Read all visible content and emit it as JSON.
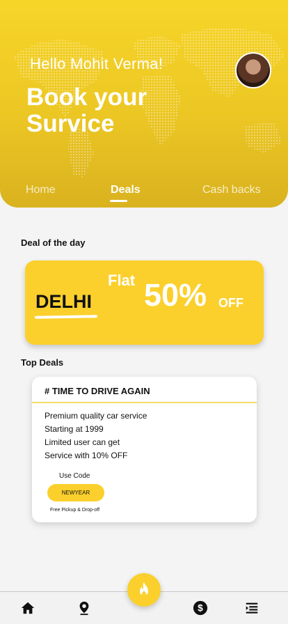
{
  "header": {
    "greeting": "Hello Mohit Verma!",
    "headline": "Book your Survice",
    "tabs": [
      {
        "label": "Home",
        "active": false
      },
      {
        "label": "Deals",
        "active": true
      },
      {
        "label": "Cash backs",
        "active": false
      }
    ]
  },
  "deal_of_day": {
    "section_title": "Deal of the day",
    "city": "DELHI",
    "flat": "Flat",
    "percent": "50%",
    "off": "OFF"
  },
  "top_deals": {
    "section_title": "Top Deals",
    "card": {
      "title": "# TIME TO DRIVE AGAIN",
      "lines": [
        "Premium quality car service",
        "Starting at 1999",
        "Limited user can get",
        "Service with 10% OFF"
      ],
      "use_code_label": "Use Code",
      "code": "NEWYEAR",
      "note": "Free Pickup & Drop-off"
    }
  },
  "bottom_nav": {
    "icons": [
      "home-icon",
      "location-pin-icon",
      "fire-icon",
      "dollar-icon",
      "menu-list-icon"
    ]
  },
  "colors": {
    "brand_yellow": "#fbd02c",
    "header_gradient_top": "#f7d528",
    "header_gradient_bottom": "#d9b21f",
    "background": "#f4f4f4"
  }
}
